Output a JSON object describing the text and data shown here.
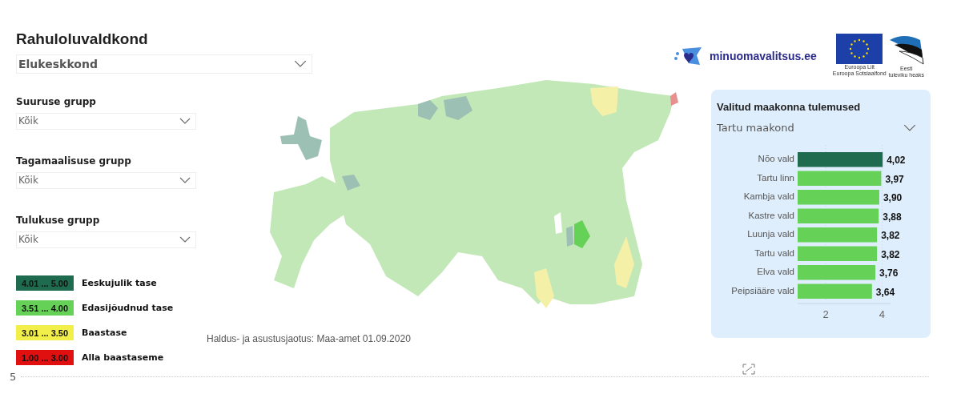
{
  "title": "Rahuloluvaldkond",
  "domain_select": {
    "value": "Elukeskkond"
  },
  "filters": [
    {
      "label": "Suuruse grupp",
      "value": "Kõik"
    },
    {
      "label": "Tagamaalisuse grupp",
      "value": "Kõik"
    },
    {
      "label": "Tulukuse grupp",
      "value": "Kõik"
    }
  ],
  "legend": [
    {
      "range": "4.01 ... 5.00",
      "label": "Eeskujulik tase",
      "color": "#1e6b4f"
    },
    {
      "range": "3.51 ... 4.00",
      "label": "Edasijõudnud tase",
      "color": "#66d157"
    },
    {
      "range": "3.01 ... 3.50",
      "label": "Baastase",
      "color": "#f2ee4a"
    },
    {
      "range": "1.00 ... 3.00",
      "label": "Alla baastaseme",
      "color": "#e01010"
    }
  ],
  "map_caption": "Haldus- ja asustusjaotus: Maa-amet 01.09.2020",
  "logos": {
    "site": "minuomavalitsus.ee",
    "eu_lines": [
      "Euroopa Liit",
      "Euroopa Sotsiaalfond"
    ],
    "estonia_lines": [
      "Eesti",
      "tuleviku heaks"
    ]
  },
  "county_panel": {
    "title": "Valitud maakonna tulemused",
    "select": {
      "value": "Tartu maakond"
    },
    "chart_data": {
      "type": "bar",
      "orientation": "horizontal",
      "categories": [
        "Nõo vald",
        "Tartu linn",
        "Kambja vald",
        "Kastre vald",
        "Luunja vald",
        "Tartu vald",
        "Elva vald",
        "Peipsiääre vald"
      ],
      "series": [
        {
          "color": "#1e6b4f",
          "values": [
            4.02,
            null,
            null,
            null,
            null,
            null,
            null,
            null
          ]
        },
        {
          "color": "#66d157",
          "values": [
            null,
            3.97,
            3.9,
            3.88,
            3.82,
            3.82,
            3.76,
            3.64
          ]
        }
      ],
      "value_labels": [
        "4,02",
        "3,97",
        "3,90",
        "3,88",
        "3,82",
        "3,82",
        "3,76",
        "3,64"
      ],
      "xlim": [
        1,
        4.3
      ],
      "xticks": [
        2,
        4
      ]
    }
  },
  "page_number": "5"
}
